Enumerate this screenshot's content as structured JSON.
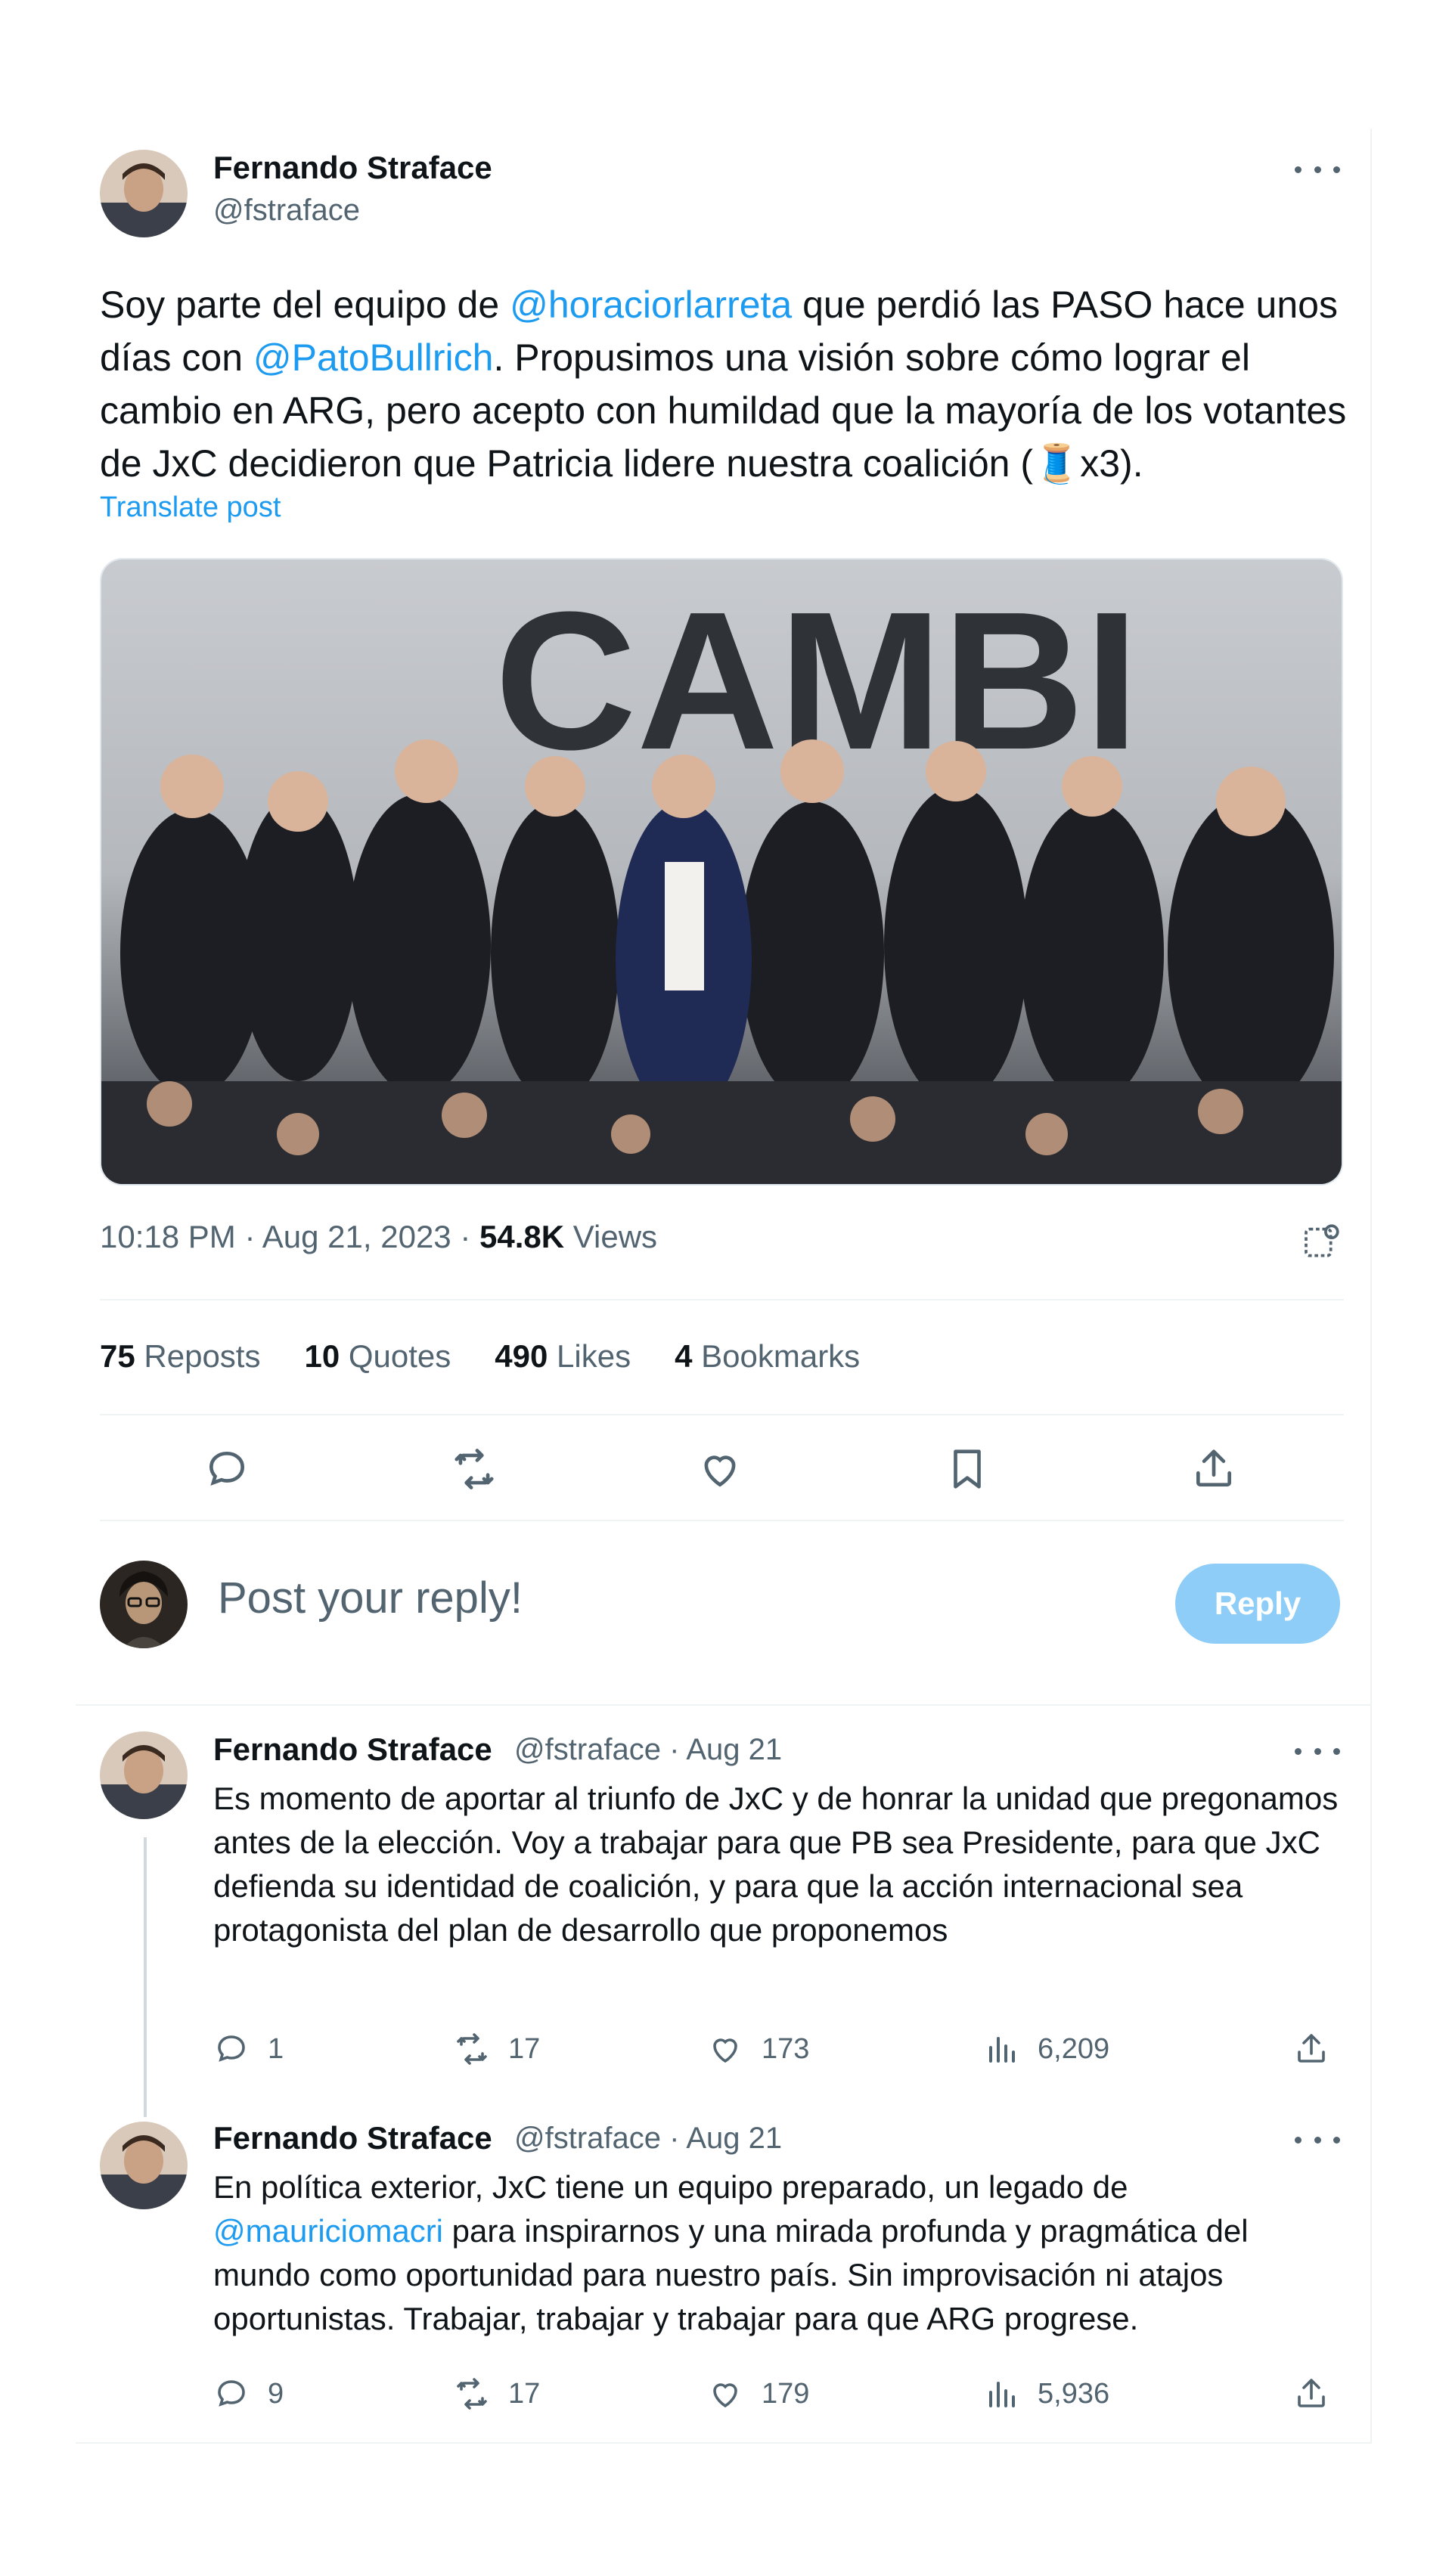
{
  "post": {
    "author_name": "Fernando Straface",
    "author_handle": "@fstraface",
    "text_1": "Soy parte del equipo de ",
    "mention_1": "@horaciorlarreta",
    "text_2": " que perdió las PASO hace unos días con ",
    "mention_2": "@PatoBullrich",
    "text_3": ". Propusimos una visión sobre cómo lograr el cambio en ARG, pero acepto con humildad que la mayoría de los votantes de JxC decidieron que Patricia lidere nuestra coalición (",
    "emoji": "🧵",
    "text_4": "x3).",
    "translate_label": "Translate post",
    "image_headline": "CAMBI",
    "timestamp": "10:18 PM · Aug 21, 2023 · ",
    "views_count": "54.8K",
    "views_label": " Views",
    "stats": {
      "reposts_count": "75",
      "reposts_label": "Reposts",
      "quotes_count": "10",
      "quotes_label": "Quotes",
      "likes_count": "490",
      "likes_label": "Likes",
      "bookmarks_count": "4",
      "bookmarks_label": "Bookmarks"
    }
  },
  "reply_box": {
    "placeholder": "Post your reply!",
    "button_label": "Reply"
  },
  "replies": [
    {
      "author_name": "Fernando Straface",
      "meta": "@fstraface · Aug 21",
      "text": "Es momento de aportar al triunfo de JxC y de honrar la unidad que pregonamos antes de la elección. Voy a trabajar para que PB sea Presidente, para que JxC defienda su identidad de coalición, y para que la acción internacional sea protagonista del plan de desarrollo que proponemos",
      "replies_count": "1",
      "reposts_count": "17",
      "likes_count": "173",
      "views_count": "6,209"
    },
    {
      "author_name": "Fernando Straface",
      "meta": "@fstraface · Aug 21",
      "text_1": "En política exterior, JxC tiene un equipo preparado, un legado de ",
      "mention": "@mauriciomacri",
      "text_2": " para inspirarnos y una mirada profunda y pragmática del mundo como oportunidad para nuestro país. Sin improvisación ni atajos oportunistas. Trabajar, trabajar y trabajar para que ARG progrese.",
      "replies_count": "9",
      "reposts_count": "17",
      "likes_count": "179",
      "views_count": "5,936"
    }
  ],
  "colors": {
    "accent": "#1d9bf0",
    "text_primary": "#0f1419",
    "text_secondary": "#536471",
    "reply_button_disabled": "#8ecdf8",
    "divider": "#eff3f4"
  },
  "icons": [
    "more-icon",
    "reply-icon",
    "repost-icon",
    "like-icon",
    "bookmark-icon",
    "share-icon",
    "analytics-icon",
    "views-icon"
  ]
}
